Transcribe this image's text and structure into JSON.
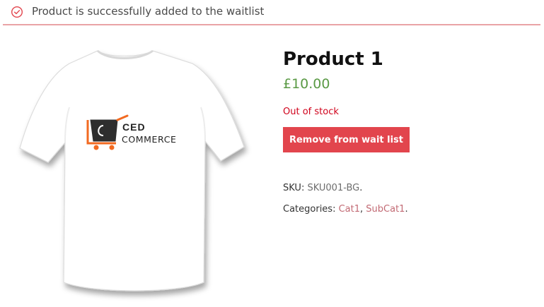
{
  "notice": {
    "icon": "check-circle-icon",
    "message": "Product is successfully added to the waitlist",
    "color": "#e2454d"
  },
  "product": {
    "image": {
      "logo_line1": "CED",
      "logo_line2": "COMMERCE",
      "logo_icon": "cart-icon"
    },
    "title": "Product 1",
    "price": "£10.00",
    "stock_status": "Out of stock",
    "button_label": "Remove from wait list",
    "sku_label": "SKU:",
    "sku_value": "SKU001-BG",
    "categories_label": "Categories:",
    "categories": [
      "Cat1",
      "SubCat1"
    ]
  },
  "colors": {
    "button": "#e2454d",
    "price": "#5a9a45",
    "out_of_stock": "#d0021b",
    "link": "#c26a74"
  }
}
